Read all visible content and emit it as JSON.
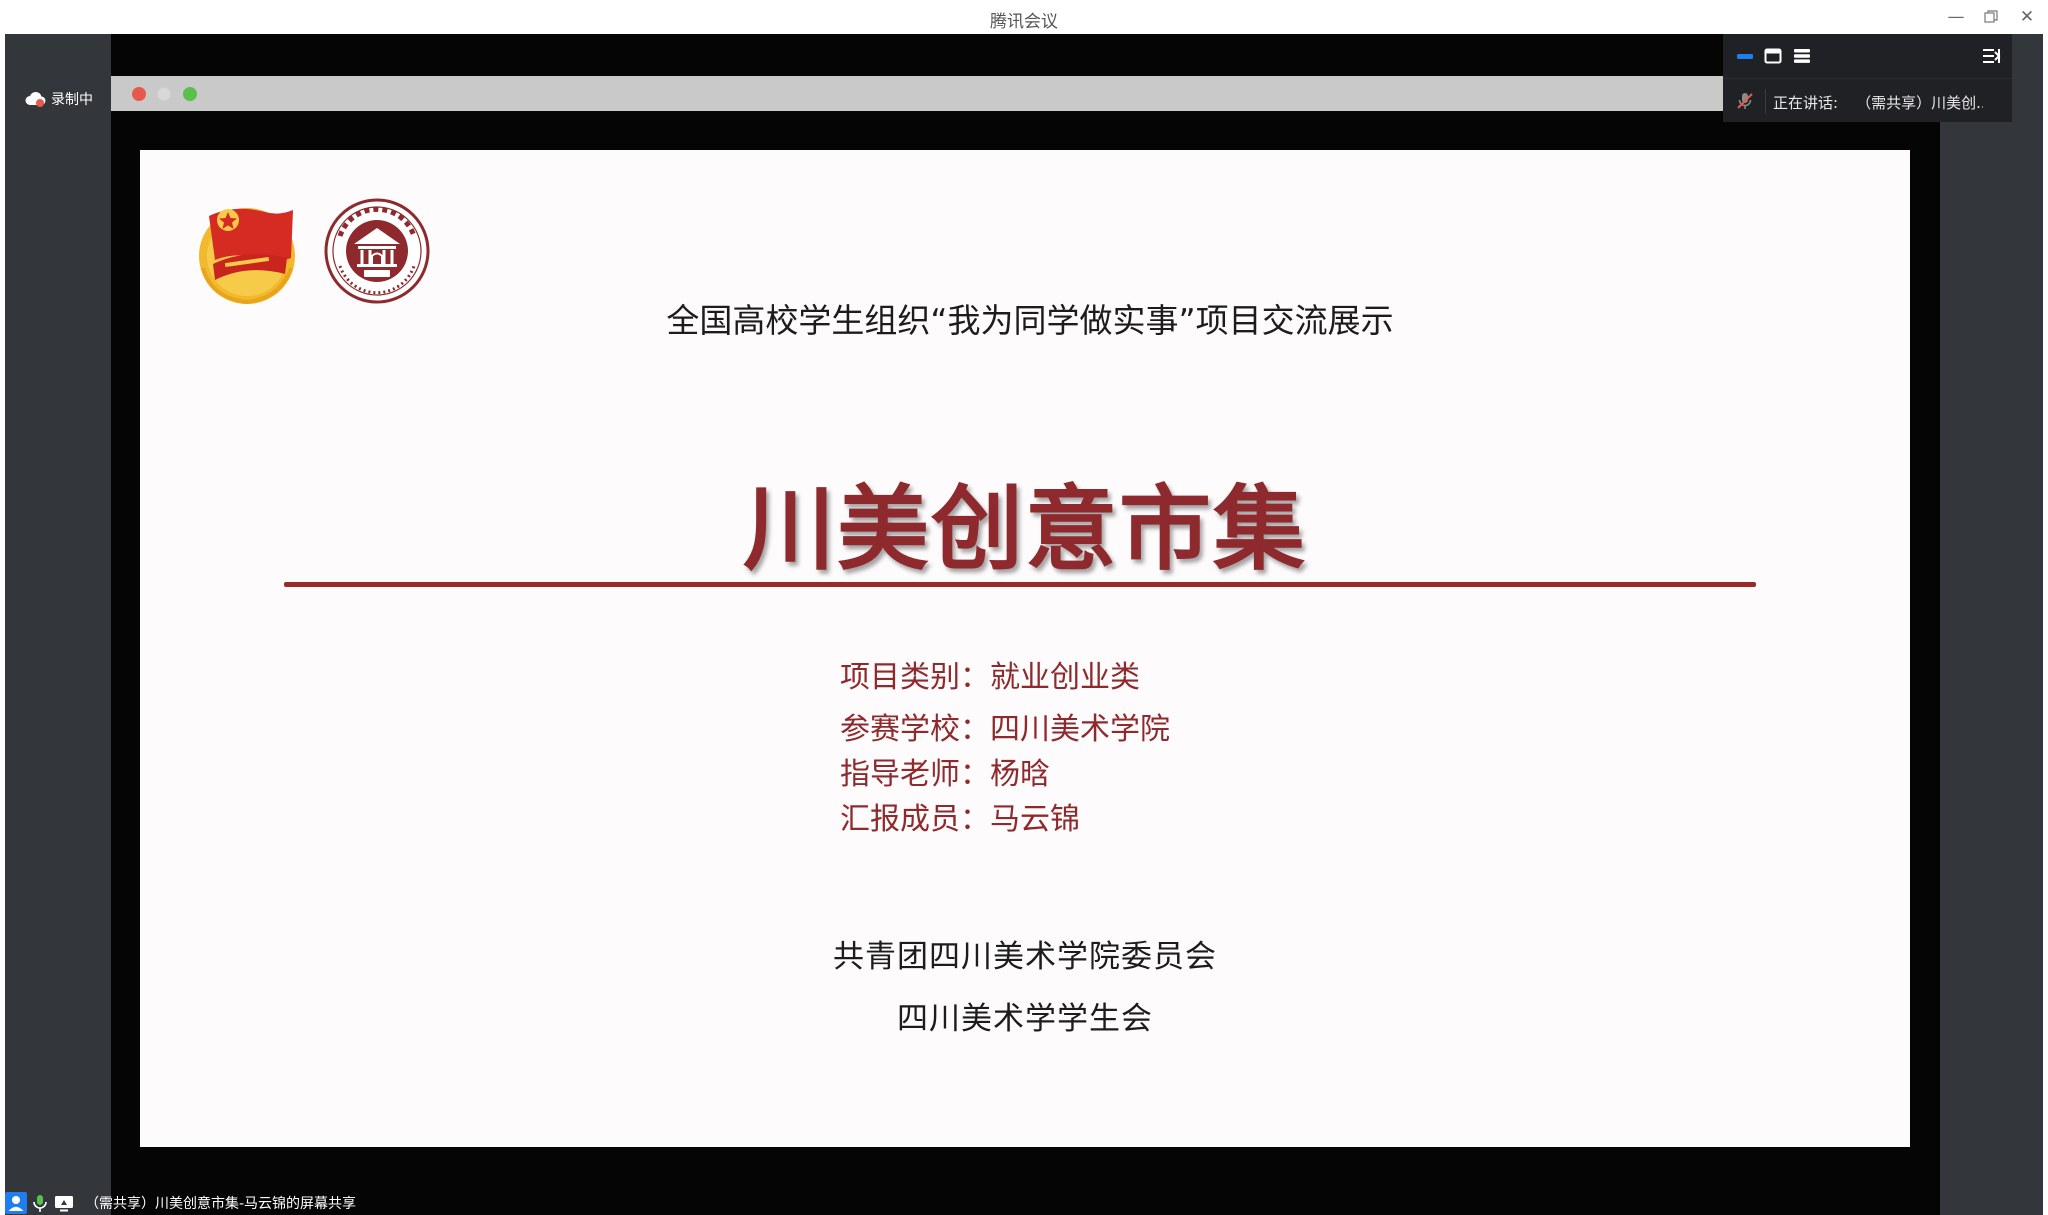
{
  "window": {
    "title": "腾讯会议",
    "minimize_icon": "minimize-icon",
    "maximize_icon": "restore-icon",
    "close_icon": "close-icon"
  },
  "recording": {
    "label": "录制中",
    "icon": "cloud-record-icon",
    "color": "#e8594d"
  },
  "toolbar": {
    "icons": [
      "minimize-bar-icon",
      "window-icon",
      "list-icon",
      "sidebar-toggle-icon"
    ],
    "accent": "#1e7ef0",
    "speaking_label": "正在讲话:",
    "speaking_name": "（需共享）川美创..."
  },
  "slide": {
    "subtitle": "全国高校学生组织“我为同学做实事”项目交流展示",
    "title": "川美创意市集",
    "info": [
      {
        "label": "项目类别：",
        "value": "就业创业类"
      },
      {
        "label": "参赛学校：",
        "value": "四川美术学院"
      },
      {
        "label": "指导老师：",
        "value": "杨晗"
      },
      {
        "label": "汇报成员：",
        "value": "马云锦"
      }
    ],
    "org": [
      "共青团四川美术学院委员会",
      "四川美术学学生会"
    ],
    "accent": "#8e2a2d",
    "logos": [
      "youth-league-emblem",
      "sichuan-fine-arts-seal"
    ]
  },
  "status": {
    "text": "（需共享）川美创意市集-马云锦的屏幕共享",
    "icons": [
      "user-icon",
      "mic-icon",
      "screen-share-icon"
    ]
  }
}
